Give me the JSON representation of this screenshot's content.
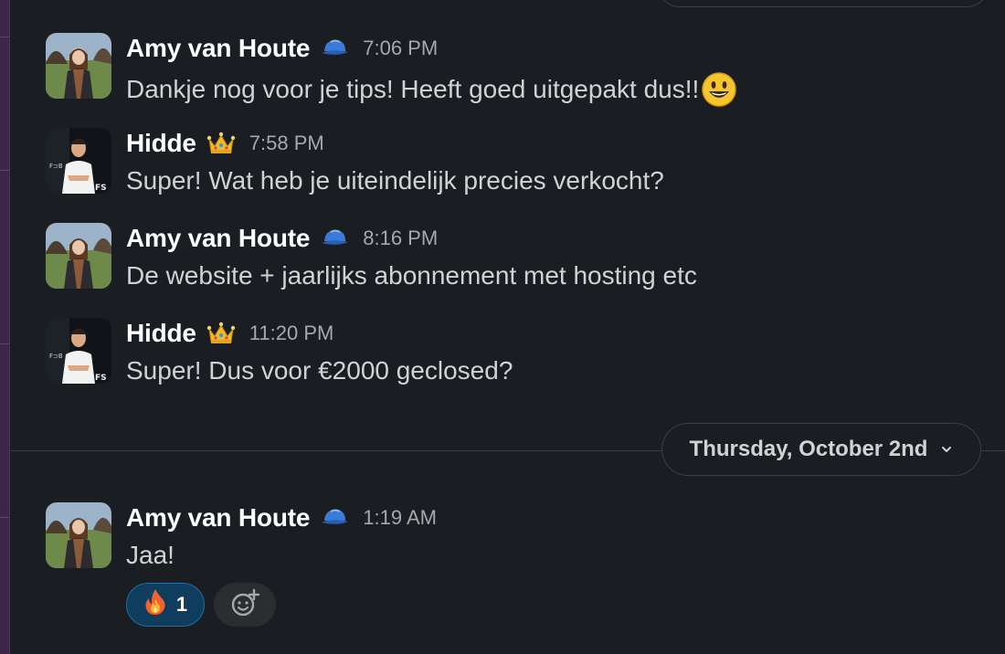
{
  "messages": [
    {
      "author": "Amy van Houte",
      "status_emoji": "blue-cap-icon",
      "time": "7:06 PM",
      "text": "Dankje nog voor je tips! Heeft goed uitgepakt dus!!",
      "inline_emoji": "smiley-emoji"
    },
    {
      "author": "Hidde",
      "status_emoji": "crown-icon",
      "time": "7:58 PM",
      "text": "Super! Wat heb je uiteindelijk precies verkocht?"
    },
    {
      "author": "Amy van Houte",
      "status_emoji": "blue-cap-icon",
      "time": "8:16 PM",
      "text": "De website + jaarlijks abonnement met hosting etc"
    },
    {
      "author": "Hidde",
      "status_emoji": "crown-icon",
      "time": "11:20 PM",
      "text": "Super! Dus voor €2000 geclosed?"
    },
    {
      "author": "Amy van Houte",
      "status_emoji": "blue-cap-icon",
      "time": "1:19 AM",
      "text": "Jaa!"
    }
  ],
  "date_divider": {
    "label": "Thursday, October 2nd",
    "icon": "chevron-down-icon"
  },
  "reactions": [
    {
      "emoji": "fire-emoji",
      "count": "1"
    },
    {
      "emoji": "add-reaction-icon"
    }
  ],
  "colors": {
    "background": "#1a1d21",
    "author_text": "#ffffff",
    "message_text": "#d1d2d3",
    "timestamp": "#a6a8ab",
    "reaction_active_bg": "#0e3d5e",
    "reaction_active_border": "#1d6fa5",
    "sidebar": "#3d2746"
  }
}
